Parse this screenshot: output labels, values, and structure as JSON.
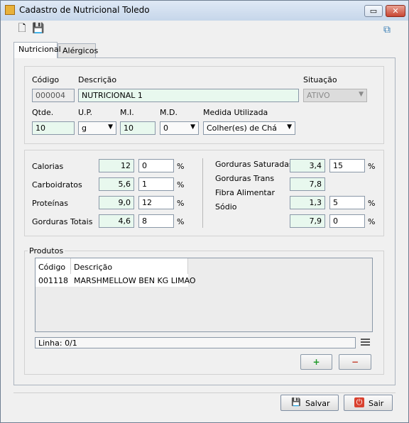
{
  "window": {
    "title": "Cadastro de Nutricional Toledo",
    "minimize": "▭",
    "close": "✕"
  },
  "toolbar": {
    "new_icon": "🗋",
    "save_icon": "💾",
    "windows_icon": "⧉"
  },
  "tabs": [
    {
      "label": "Nutricional"
    },
    {
      "label": "Alérgicos"
    }
  ],
  "form": {
    "codigo": {
      "label": "Código",
      "value": "000004"
    },
    "descricao": {
      "label": "Descrição",
      "value": "NUTRICIONAL 1"
    },
    "situacao": {
      "label": "Situação",
      "value": "ATIVO"
    },
    "qtde": {
      "label": "Qtde.",
      "value": "10"
    },
    "up": {
      "label": "U.P.",
      "value": "g"
    },
    "mi": {
      "label": "M.I.",
      "value": "10"
    },
    "md": {
      "label": "M.D.",
      "value": "0"
    },
    "medida": {
      "label": "Medida Utilizada",
      "value": "Colher(es) de Chá"
    }
  },
  "nutrients_left": [
    {
      "label": "Calorias",
      "value": "12",
      "pct": "0",
      "unit": "%"
    },
    {
      "label": "Carboidratos",
      "value": "5,6",
      "pct": "1",
      "unit": "%"
    },
    {
      "label": "Proteínas",
      "value": "9,0",
      "pct": "12",
      "unit": "%"
    },
    {
      "label": "Gorduras Totais",
      "value": "4,6",
      "pct": "8",
      "unit": "%"
    }
  ],
  "nutrients_right": [
    {
      "label": "Gorduras Saturadas",
      "value": "3,4",
      "pct": "15",
      "unit": "%"
    },
    {
      "label": "Gorduras Trans",
      "value": "7,8"
    },
    {
      "label": "Fibra Alimentar"
    },
    {
      "label": "Sódio",
      "value": "1,3",
      "pct": "5",
      "unit": "%"
    },
    {
      "value": "7,9",
      "pct": "0",
      "unit": "%"
    }
  ],
  "produtos": {
    "legend": "Produtos",
    "columns": [
      "Código",
      "Descrição"
    ],
    "rows": [
      [
        "001118",
        "MARSHMELLOW BEN KG LIMAO"
      ]
    ],
    "status": "Linha: 0/1"
  },
  "actions": {
    "add_icon": "+",
    "remove_icon": "−"
  },
  "footer": {
    "save_label": "Salvar",
    "exit_label": "Sair",
    "save_icon": "💾",
    "exit_icon": "⏻"
  }
}
